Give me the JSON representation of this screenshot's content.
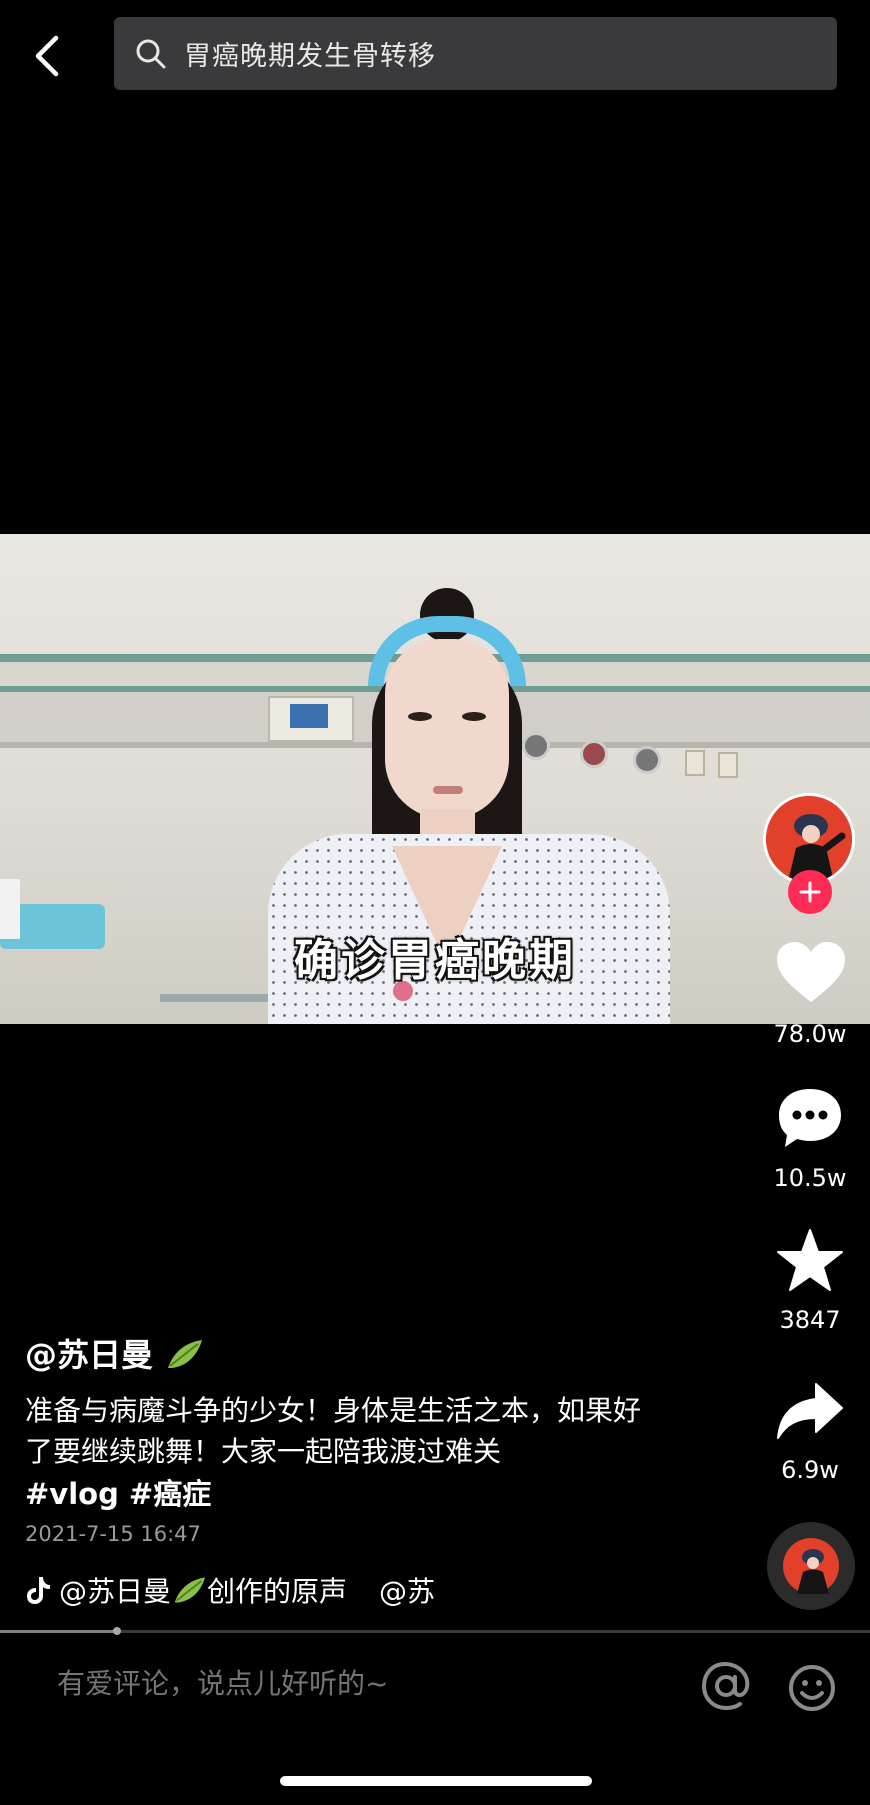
{
  "search": {
    "query": "胃癌晚期发生骨转移"
  },
  "video": {
    "subtitle": "确诊胃癌晚期"
  },
  "actions": {
    "likes": "78.0w",
    "comments": "10.5w",
    "favorites": "3847",
    "shares": "6.9w"
  },
  "post": {
    "author": "@苏日曼",
    "description": "准备与病魔斗争的少女！身体是生活之本，如果好了要继续跳舞！大家一起陪我渡过难关",
    "tags": "#vlog #癌症",
    "date": "2021-7-15 16:47",
    "music_author": "@苏日曼",
    "music_suffix": "创作的原声",
    "music_extra": "@苏"
  },
  "progress": 0.135,
  "comment_bar": {
    "placeholder": "有爱评论，说点儿好听的~"
  },
  "colors": {
    "follow": "#fe2c55",
    "background": "#000000",
    "search_bg": "#3a3a3c"
  }
}
